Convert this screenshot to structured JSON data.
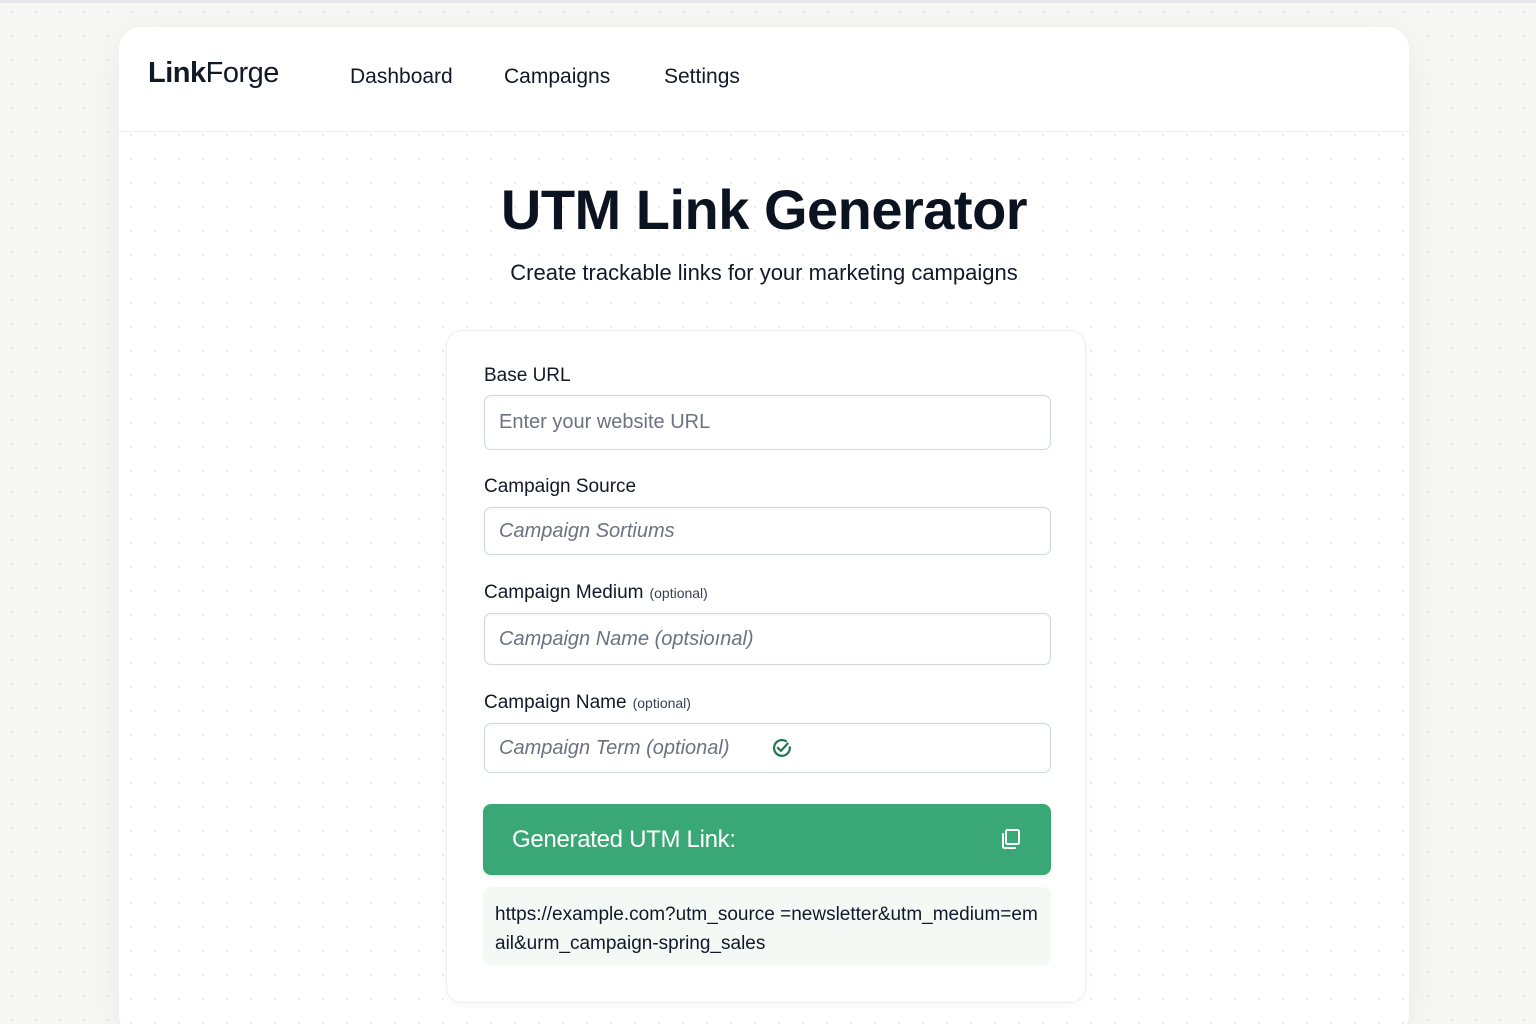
{
  "brand": {
    "name_bold": "Link",
    "name_light": "Forge"
  },
  "nav": {
    "items": [
      {
        "label": "Dashboard"
      },
      {
        "label": "Campaigns"
      },
      {
        "label": "Settings"
      }
    ]
  },
  "page": {
    "title": "UTM Link Generator",
    "subtitle": "Create trackable links for your marketing campaigns"
  },
  "form": {
    "base_url": {
      "label": "Base URL",
      "placeholder": "Enter your website URL",
      "value": ""
    },
    "campaign_source": {
      "label": "Campaign Source",
      "placeholder": "Campaign Sortiums",
      "value": ""
    },
    "campaign_medium": {
      "label": "Campaign Medium",
      "optional": "(optional)",
      "placeholder": "Campaign Name (optsioınal)",
      "value": ""
    },
    "campaign_name": {
      "label": "Campaign Name",
      "optional": "(optional)",
      "placeholder": "Campaign Term (optional)",
      "value": ""
    },
    "generate_button_label": "Generated UTM Link:",
    "result_url": "https://example.com?utm_source =newsletter&utm_medium=email&urm_campaign-spring_sales"
  },
  "colors": {
    "accent": "#3aa876",
    "check": "#1e7a4c",
    "result_bg": "#f5f9f6"
  },
  "icons": {
    "valid": "check-circle-icon",
    "copy": "copy-icon"
  }
}
